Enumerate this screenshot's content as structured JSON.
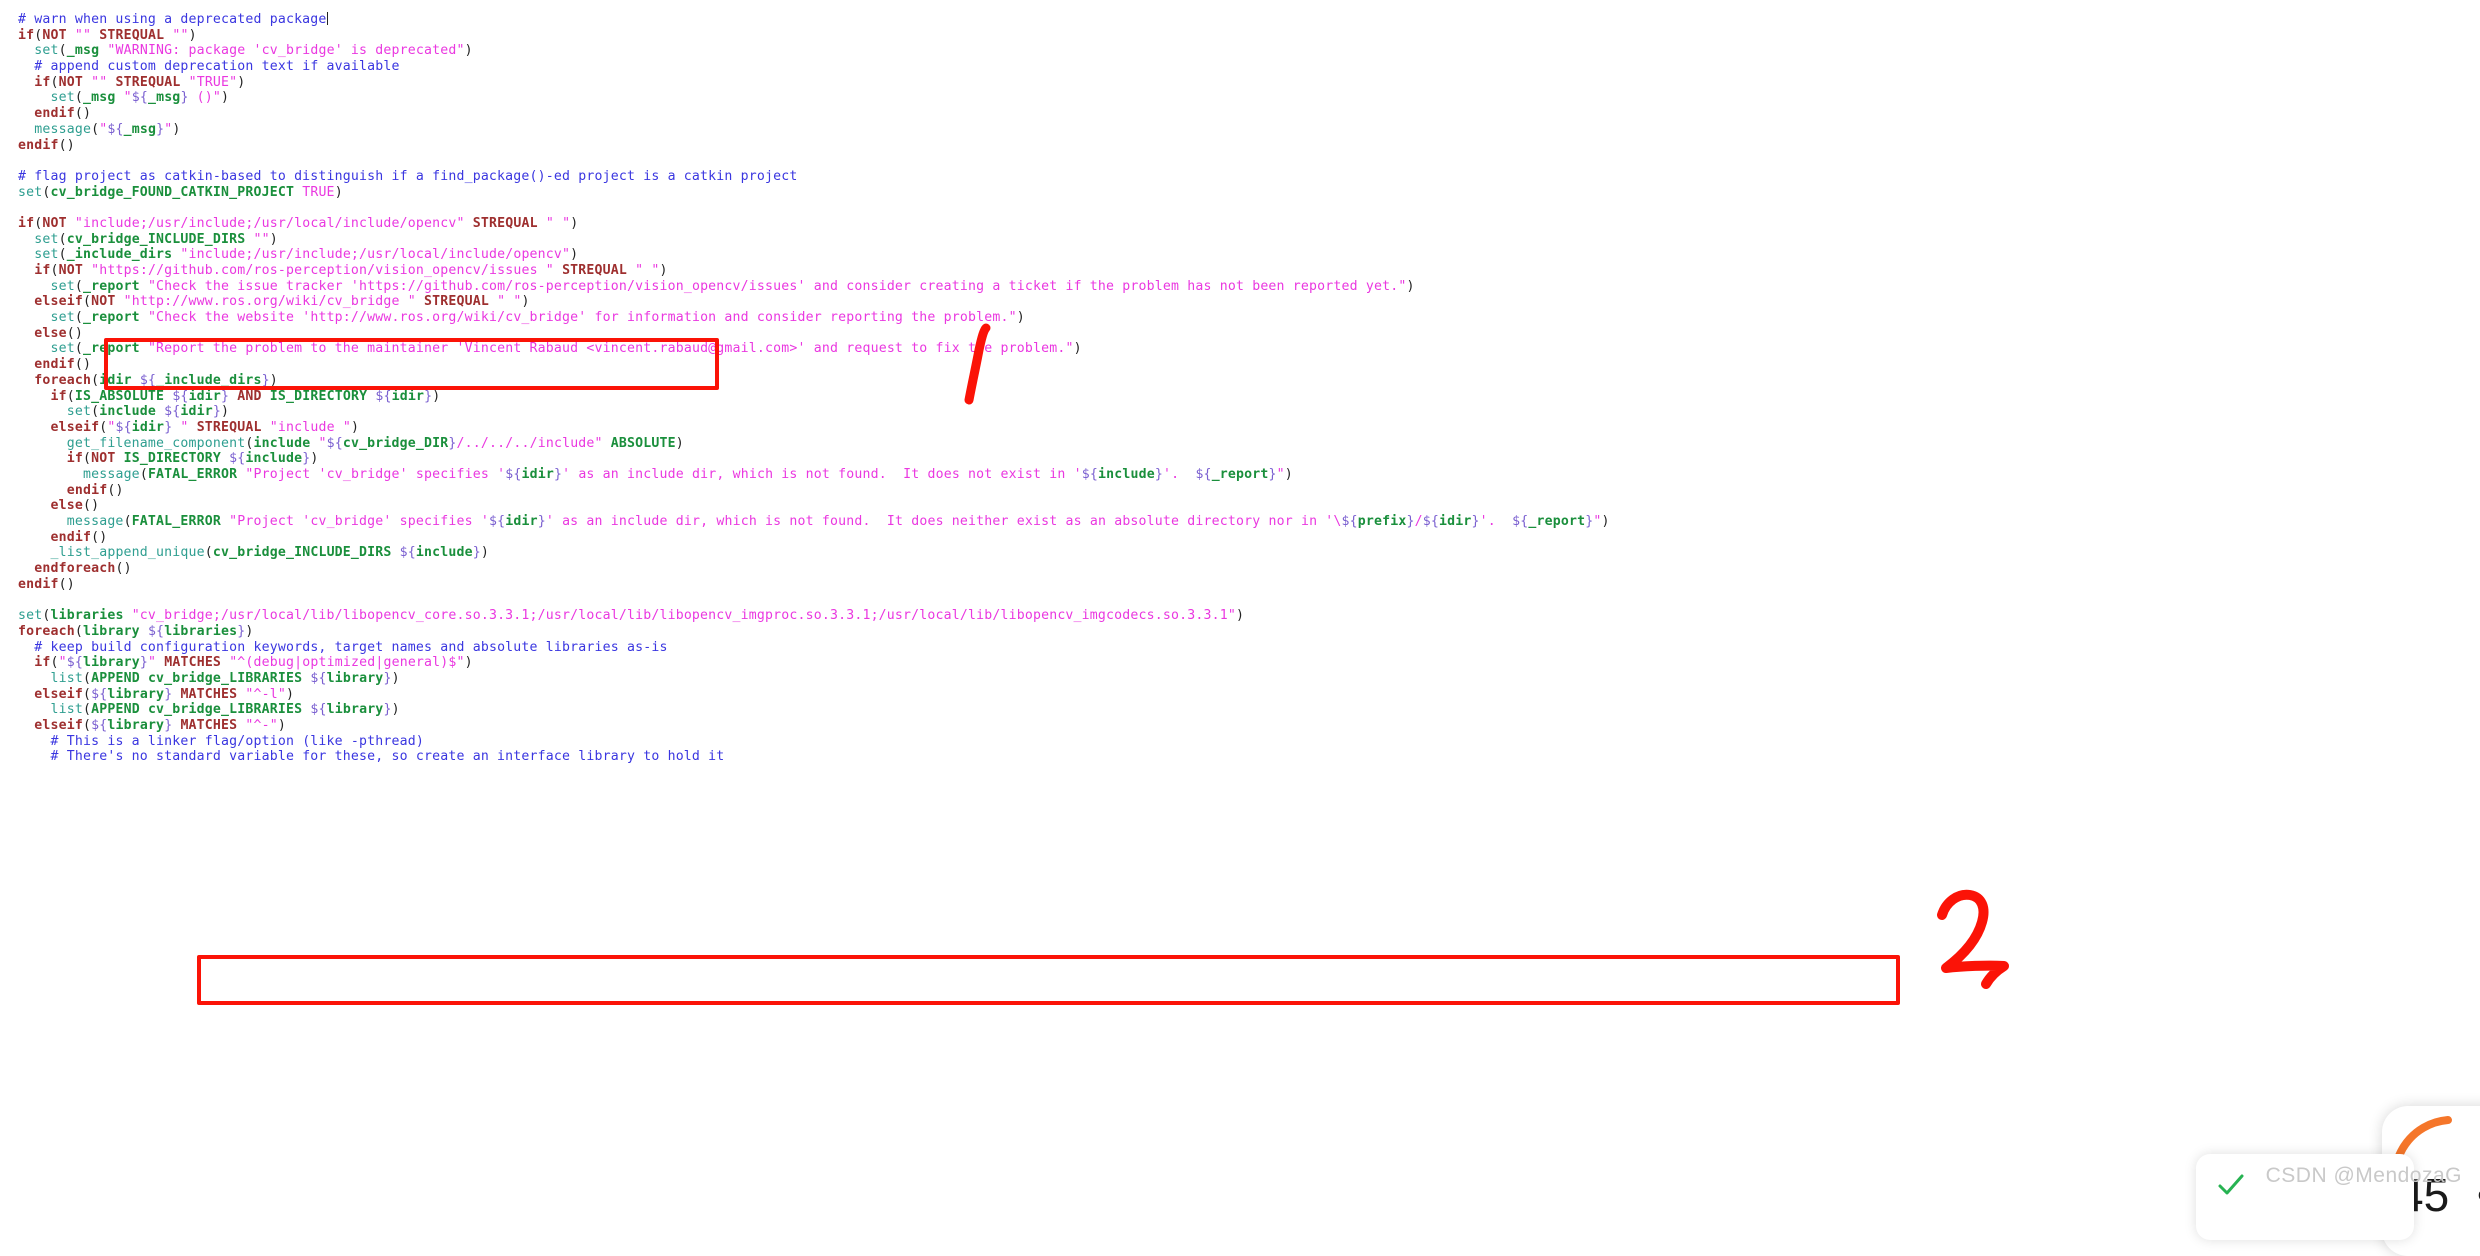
{
  "editor": {
    "language": "cmake",
    "background": "#ffffff",
    "colors": {
      "comment": "#3a36e0",
      "keyword": "#9e2f2f",
      "command": "#2e9e90",
      "string": "#ea38e0",
      "variable": "#1a8f3c",
      "brace": "#7a5fd0",
      "plain": "#222222",
      "annotation": "#fb1307"
    },
    "caret_after_line": 1,
    "lines": [
      "# warn when using a deprecated package",
      "if(NOT \"\" STREQUAL \"\")",
      "  set(_msg \"WARNING: package 'cv_bridge' is deprecated\")",
      "  # append custom deprecation text if available",
      "  if(NOT \"\" STREQUAL \"TRUE\")",
      "    set(_msg \"${_msg} ()\")",
      "  endif()",
      "  message(\"${_msg}\")",
      "endif()",
      "",
      "# flag project as catkin-based to distinguish if a find_package()-ed project is a catkin project",
      "set(cv_bridge_FOUND_CATKIN_PROJECT TRUE)",
      "",
      "if(NOT \"include;/usr/include;/usr/local/include/opencv\" STREQUAL \" \")",
      "  set(cv_bridge_INCLUDE_DIRS \"\")",
      "  set(_include_dirs \"include;/usr/include;/usr/local/include/opencv\")",
      "  if(NOT \"https://github.com/ros-perception/vision_opencv/issues \" STREQUAL \" \")",
      "    set(_report \"Check the issue tracker 'https://github.com/ros-perception/vision_opencv/issues' and consider creating a ticket if the problem has not been reported yet.\")",
      "  elseif(NOT \"http://www.ros.org/wiki/cv_bridge \" STREQUAL \" \")",
      "    set(_report \"Check the website 'http://www.ros.org/wiki/cv_bridge' for information and consider reporting the problem.\")",
      "  else()",
      "    set(_report \"Report the problem to the maintainer 'Vincent Rabaud <vincent.rabaud@gmail.com>' and request to fix the problem.\")",
      "  endif()",
      "  foreach(idir ${_include_dirs})",
      "    if(IS_ABSOLUTE ${idir} AND IS_DIRECTORY ${idir})",
      "      set(include ${idir})",
      "    elseif(\"${idir} \" STREQUAL \"include \")",
      "      get_filename_component(include \"${cv_bridge_DIR}/../../../include\" ABSOLUTE)",
      "      if(NOT IS_DIRECTORY ${include})",
      "        message(FATAL_ERROR \"Project 'cv_bridge' specifies '${idir}' as an include dir, which is not found.  It does not exist in '${include}'.  ${_report}\")",
      "      endif()",
      "    else()",
      "      message(FATAL_ERROR \"Project 'cv_bridge' specifies '${idir}' as an include dir, which is not found.  It does neither exist as an absolute directory nor in '\\${prefix}/${idir}'.  ${_report}\")",
      "    endif()",
      "    _list_append_unique(cv_bridge_INCLUDE_DIRS ${include})",
      "  endforeach()",
      "endif()",
      "",
      "set(libraries \"cv_bridge;/usr/local/lib/libopencv_core.so.3.3.1;/usr/local/lib/libopencv_imgproc.so.3.3.1;/usr/local/lib/libopencv_imgcodecs.so.3.3.1\")",
      "foreach(library ${libraries})",
      "  # keep build configuration keywords, target names and absolute libraries as-is",
      "  if(\"${library}\" MATCHES \"^(debug|optimized|general)$\")",
      "    list(APPEND cv_bridge_LIBRARIES ${library})",
      "  elseif(${library} MATCHES \"^-l\")",
      "    list(APPEND cv_bridge_LIBRARIES ${library})",
      "  elseif(${library} MATCHES \"^-\")",
      "    # This is a linker flag/option (like -pthread)",
      "    # There's no standard variable for these, so create an interface library to hold it"
    ]
  },
  "annotations": {
    "box_1": {
      "label": "1",
      "highlights": "\"include;/usr/include;/usr/local/include/opencv\"",
      "color": "#fb1307"
    },
    "box_2": {
      "label": "2",
      "highlights": "\"cv_bridge;/usr/local/lib/libopencv_core.so.3.3.1;/usr/local/lib/libopencv_imgproc.so.3.3.1;/usr/local/lib/libopencv_imgcodecs.so.3.3.1\"",
      "color": "#fb1307"
    }
  },
  "watermark": {
    "text": "CSDN @MendozaG"
  },
  "overlay_widget": {
    "percent": "45",
    "percent_symbol": "%",
    "accent_color": "#f5762a"
  }
}
